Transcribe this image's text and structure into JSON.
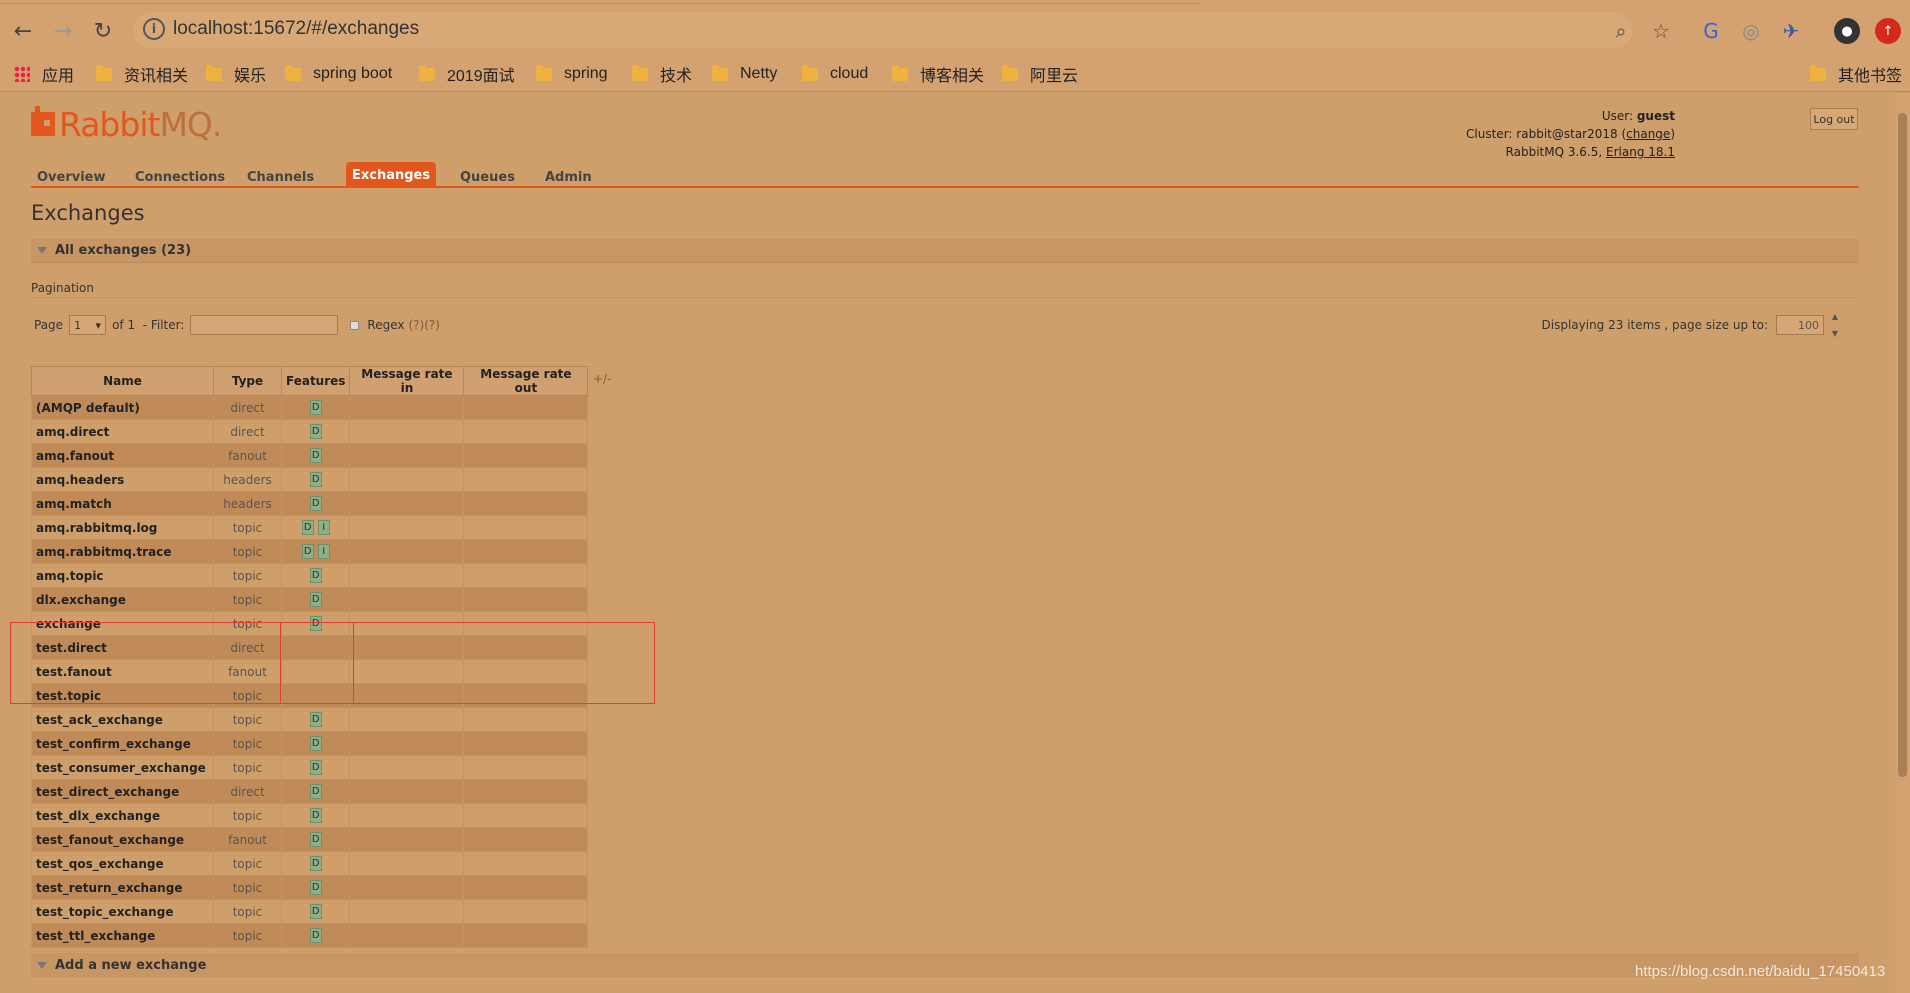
{
  "browser": {
    "url": "localhost:15672/#/exchanges",
    "bookmarks": [
      "应用",
      "资讯相关",
      "娱乐",
      "spring boot",
      "2019面试",
      "spring",
      "技术",
      "Netty",
      "cloud",
      "博客相关",
      "阿里云",
      "其他书签"
    ]
  },
  "header": {
    "logo_primary": "Rabbit",
    "logo_secondary": "MQ.",
    "user_label": "User:",
    "user": "guest",
    "cluster_label": "Cluster:",
    "cluster": "rabbit@star2018",
    "change_label": "change",
    "version": "RabbitMQ 3.6.5,",
    "erlang": "Erlang 18.1",
    "logout_label": "Log out"
  },
  "tabs": [
    "Overview",
    "Connections",
    "Channels",
    "Exchanges",
    "Queues",
    "Admin"
  ],
  "main": {
    "title": "Exchanges",
    "section_all": "All exchanges (23)",
    "pagination_label": "Pagination",
    "page_label": "Page",
    "page_value": "1",
    "of_label": "of 1",
    "filter_label": "- Filter:",
    "filter_value": "",
    "regex_label": "Regex",
    "regex_help": "(?)(?)",
    "display_label": "Displaying 23 items , page size up to:",
    "page_size": "100",
    "plus_minus": "+/-",
    "section_add": "Add a new exchange"
  },
  "table": {
    "headers": [
      "Name",
      "Type",
      "Features",
      "Message rate in",
      "Message rate out"
    ],
    "rows": [
      {
        "name": "(AMQP default)",
        "type": "direct",
        "features": [
          "D"
        ]
      },
      {
        "name": "amq.direct",
        "type": "direct",
        "features": [
          "D"
        ]
      },
      {
        "name": "amq.fanout",
        "type": "fanout",
        "features": [
          "D"
        ]
      },
      {
        "name": "amq.headers",
        "type": "headers",
        "features": [
          "D"
        ]
      },
      {
        "name": "amq.match",
        "type": "headers",
        "features": [
          "D"
        ]
      },
      {
        "name": "amq.rabbitmq.log",
        "type": "topic",
        "features": [
          "D",
          "I"
        ]
      },
      {
        "name": "amq.rabbitmq.trace",
        "type": "topic",
        "features": [
          "D",
          "I"
        ]
      },
      {
        "name": "amq.topic",
        "type": "topic",
        "features": [
          "D"
        ]
      },
      {
        "name": "dlx.exchange",
        "type": "topic",
        "features": [
          "D"
        ]
      },
      {
        "name": "exchange",
        "type": "topic",
        "features": [
          "D"
        ]
      },
      {
        "name": "test.direct",
        "type": "direct",
        "features": []
      },
      {
        "name": "test.fanout",
        "type": "fanout",
        "features": []
      },
      {
        "name": "test.topic",
        "type": "topic",
        "features": []
      },
      {
        "name": "test_ack_exchange",
        "type": "topic",
        "features": [
          "D"
        ]
      },
      {
        "name": "test_confirm_exchange",
        "type": "topic",
        "features": [
          "D"
        ]
      },
      {
        "name": "test_consumer_exchange",
        "type": "topic",
        "features": [
          "D"
        ]
      },
      {
        "name": "test_direct_exchange",
        "type": "direct",
        "features": [
          "D"
        ]
      },
      {
        "name": "test_dlx_exchange",
        "type": "topic",
        "features": [
          "D"
        ]
      },
      {
        "name": "test_fanout_exchange",
        "type": "fanout",
        "features": [
          "D"
        ]
      },
      {
        "name": "test_qos_exchange",
        "type": "topic",
        "features": [
          "D"
        ]
      },
      {
        "name": "test_return_exchange",
        "type": "topic",
        "features": [
          "D"
        ]
      },
      {
        "name": "test_topic_exchange",
        "type": "topic",
        "features": [
          "D"
        ]
      },
      {
        "name": "test_ttl_exchange",
        "type": "topic",
        "features": [
          "D"
        ]
      }
    ]
  },
  "watermark": "https://blog.csdn.net/baidu_17450413",
  "colors": {
    "accent": "#e2571e",
    "background": "#cf9f6b",
    "highlight_box": "#e83a3a"
  }
}
